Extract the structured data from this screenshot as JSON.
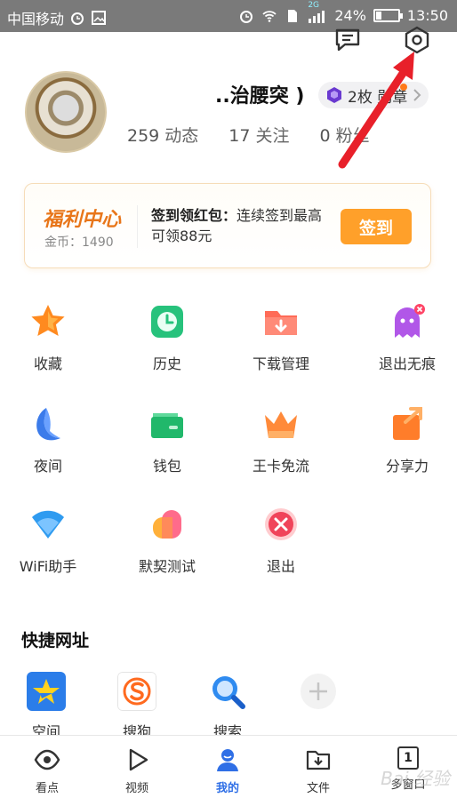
{
  "status_bar": {
    "carrier": "中国移动",
    "network_badge": "2G",
    "battery": "24%",
    "battery_level": 0.24,
    "time": "13:50"
  },
  "header": {
    "message_icon": "chat-bubble-icon",
    "settings_icon": "hexagon-gear-icon"
  },
  "profile": {
    "username": "..治腰突 )",
    "badge_text": "2枚 勋章",
    "stats": [
      {
        "num": "259",
        "label": "动态"
      },
      {
        "num": "17",
        "label": "关注"
      },
      {
        "num": "0",
        "label": "粉丝"
      }
    ]
  },
  "welfare": {
    "title": "福利中心",
    "coins": "金币：1490",
    "desc_bold": "签到领红包：",
    "desc": "连续签到最高可领88元",
    "button": "签到"
  },
  "grid": [
    {
      "label": "收藏",
      "icon": "star-icon",
      "color": "#ff8a1f"
    },
    {
      "label": "历史",
      "icon": "clock-icon",
      "color": "#27c27c"
    },
    {
      "label": "下载管理",
      "icon": "download-folder-icon",
      "color": "#ff6b57"
    },
    {
      "label": "退出无痕",
      "icon": "ghost-icon",
      "color": "#b157e8"
    },
    {
      "label": "夜间",
      "icon": "moon-icon",
      "color": "#3b7bea"
    },
    {
      "label": "钱包",
      "icon": "wallet-icon",
      "color": "#21b86b"
    },
    {
      "label": "王卡免流",
      "icon": "crown-icon",
      "color": "#ff8a3a"
    },
    {
      "label": "分享力",
      "icon": "share-icon",
      "color": "#ff7d2a"
    },
    {
      "label": "WiFi助手",
      "icon": "wifi-icon",
      "color": "#2f9bf0"
    },
    {
      "label": "默契测试",
      "icon": "hearts-icon",
      "color": "#ff6b6b"
    },
    {
      "label": "退出",
      "icon": "close-circle-icon",
      "color": "#f0445a"
    }
  ],
  "quick_links": {
    "title": "快捷网址",
    "items": [
      {
        "label": "空间",
        "icon": "qzone-icon"
      },
      {
        "label": "搜狗",
        "icon": "sogou-icon"
      },
      {
        "label": "搜索",
        "icon": "search-icon"
      },
      {
        "label": "",
        "icon": "add-icon"
      }
    ]
  },
  "bottom_nav": [
    {
      "label": "看点",
      "icon": "eye-icon"
    },
    {
      "label": "视频",
      "icon": "play-icon"
    },
    {
      "label": "我的",
      "icon": "user-icon"
    },
    {
      "label": "文件",
      "icon": "folder-download-icon"
    },
    {
      "label": "多窗口",
      "icon": "window-count-icon",
      "count": "1"
    }
  ],
  "watermark": "Bai 经验",
  "colors": {
    "accent": "#ffa02a",
    "nav_active": "#2f6fe6",
    "arrow": "#e8202a"
  }
}
